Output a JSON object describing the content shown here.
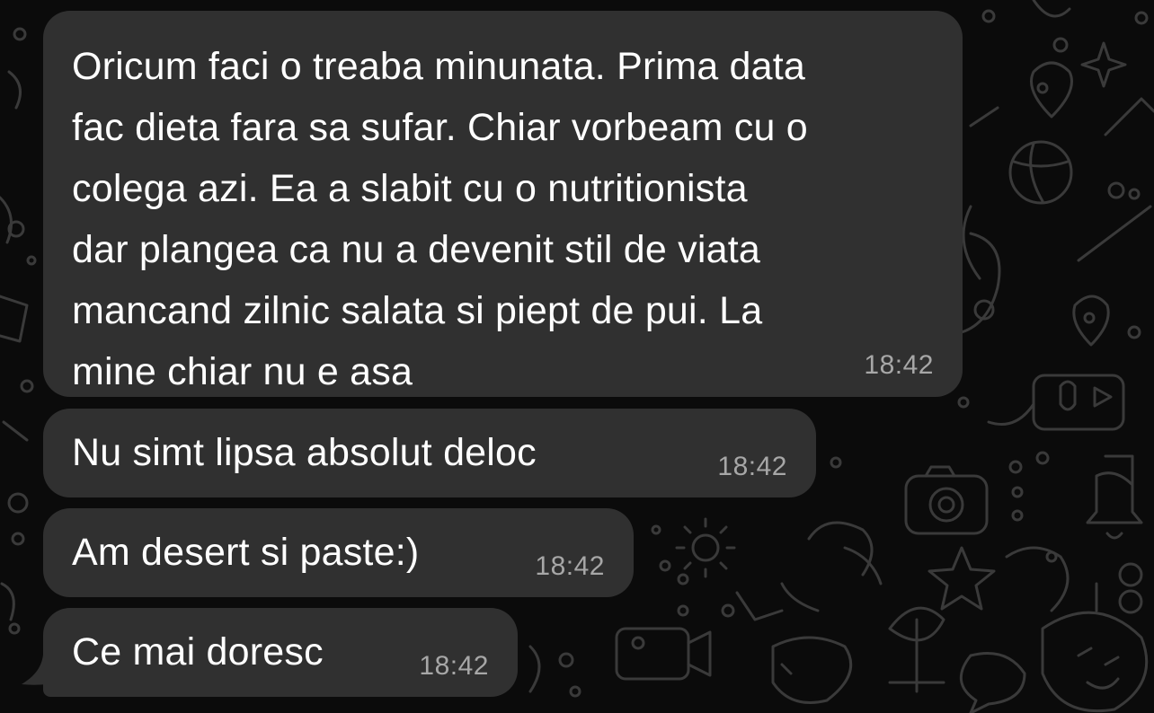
{
  "theme": {
    "background": "#0b0b0b",
    "bubble": "#303030",
    "text": "#ffffff",
    "timestamp": "#a7a7a7",
    "pattern": "#3a3a3a"
  },
  "messages": [
    {
      "text": "Oricum faci o treaba minunata. Prima data\nfac dieta fara sa sufar. Chiar vorbeam cu o\ncolega azi. Ea a slabit cu o nutritionista\ndar plangea ca nu a devenit stil de viata\nmancand zilnic salata si piept de pui. La\nmine chiar nu e asa",
      "time": "18:42"
    },
    {
      "text": "Nu simt lipsa absolut deloc",
      "time": "18:42"
    },
    {
      "text": "Am desert si paste:)",
      "time": "18:42"
    },
    {
      "text": "Ce mai doresc",
      "time": "18:42"
    }
  ],
  "wallpaper_icons": [
    "star-icon",
    "location-pin-icon",
    "basketball-icon",
    "microphone-icon",
    "play-icon",
    "camera-icon",
    "gear-icon",
    "bell-icon",
    "plant-icon",
    "video-camera-icon",
    "emoji-face-icon",
    "bubble-dots-icon"
  ]
}
